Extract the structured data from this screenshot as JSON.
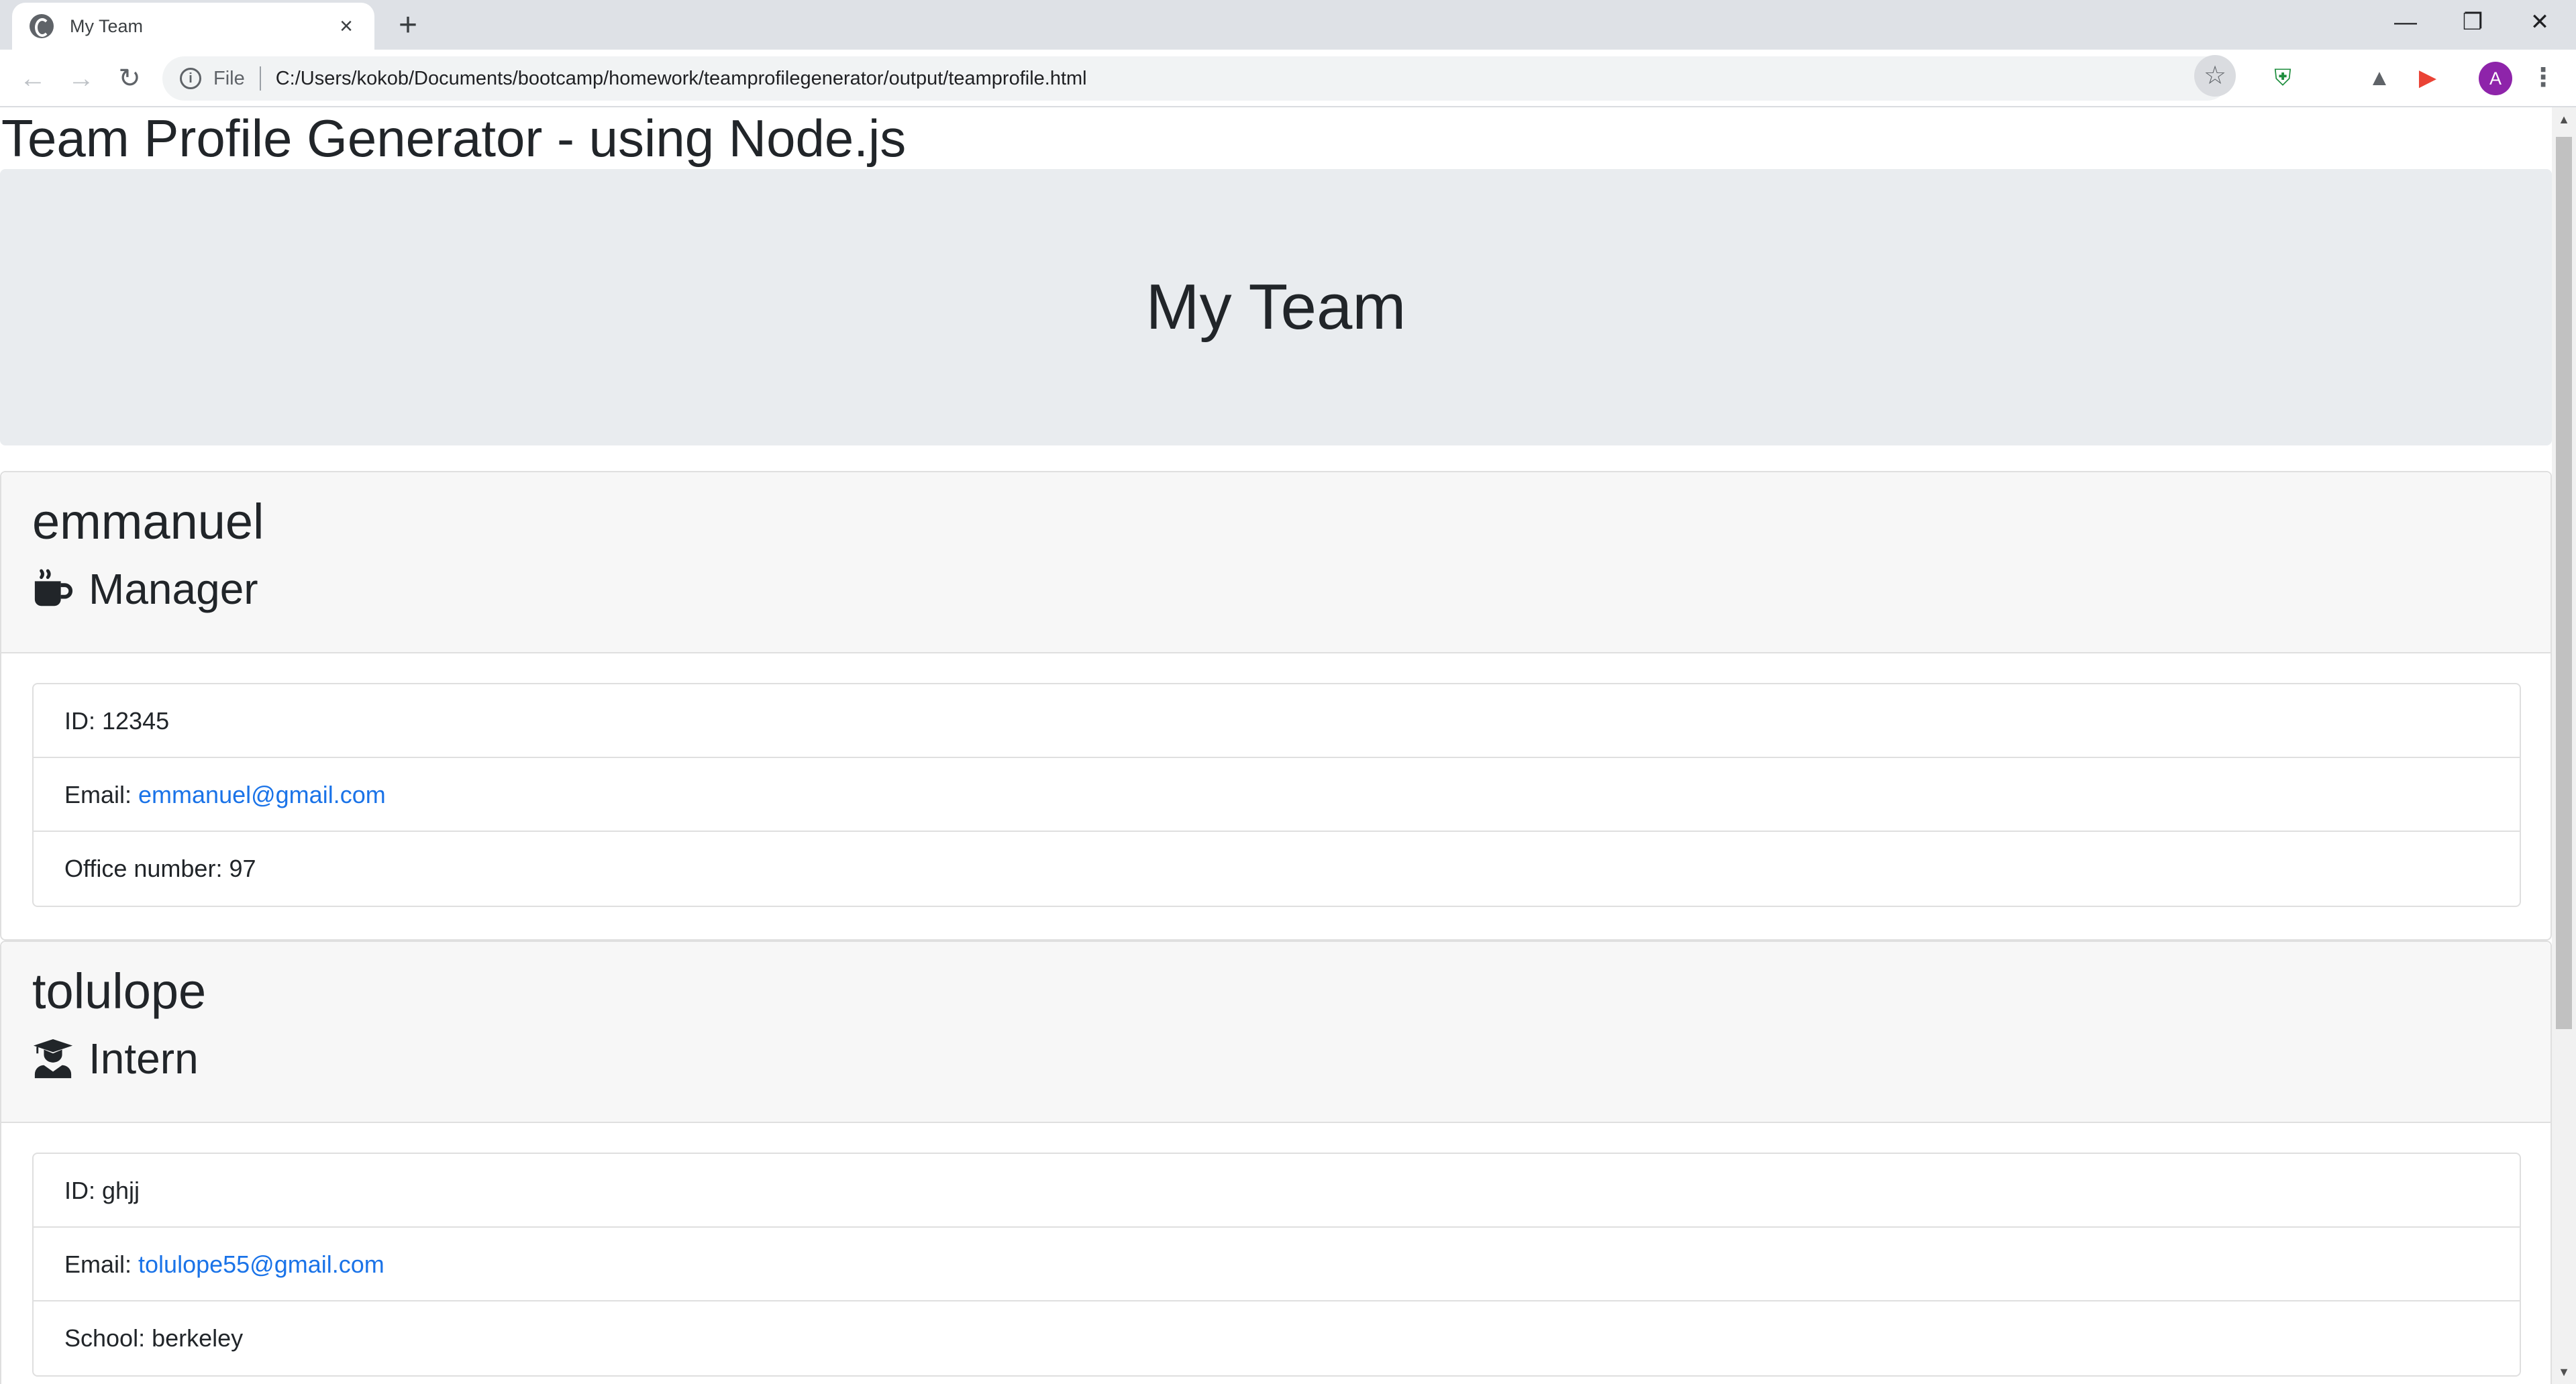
{
  "browser": {
    "tab_title": "My Team",
    "tab_close": "×",
    "new_tab": "+",
    "url_scheme": "File",
    "url": "C:/Users/kokob/Documents/bootcamp/homework/teamprofilegenerator/output/teamprofile.html",
    "profile_initial": "A",
    "icons": {
      "back": "←",
      "forward": "→",
      "reload": "↻",
      "info": "i",
      "star": "☆",
      "shield_extension": "⛨",
      "drive_extension": "▲",
      "cast_extension": "▶",
      "menu": "⋮",
      "minimize": "—",
      "maximize": "❐",
      "close": "✕"
    }
  },
  "page": {
    "heading": "Team Profile Generator - using Node.js",
    "jumbotron_title": "My Team"
  },
  "employees": [
    {
      "name": "emmanuel",
      "role": "Manager",
      "role_icon": "mug-icon",
      "id_label": "ID: ",
      "id": "12345",
      "email_label": "Email: ",
      "email": "emmanuel@gmail.com",
      "extra_label": "Office number: ",
      "extra_value": "97"
    },
    {
      "name": "tolulope",
      "role": "Intern",
      "role_icon": "graduate-icon",
      "id_label": "ID: ",
      "id": "ghjj",
      "email_label": "Email: ",
      "email": "tolulope55@gmail.com",
      "extra_label": "School: ",
      "extra_value": "berkeley"
    }
  ],
  "scrollbar": {
    "up": "▲",
    "down": "▼"
  }
}
